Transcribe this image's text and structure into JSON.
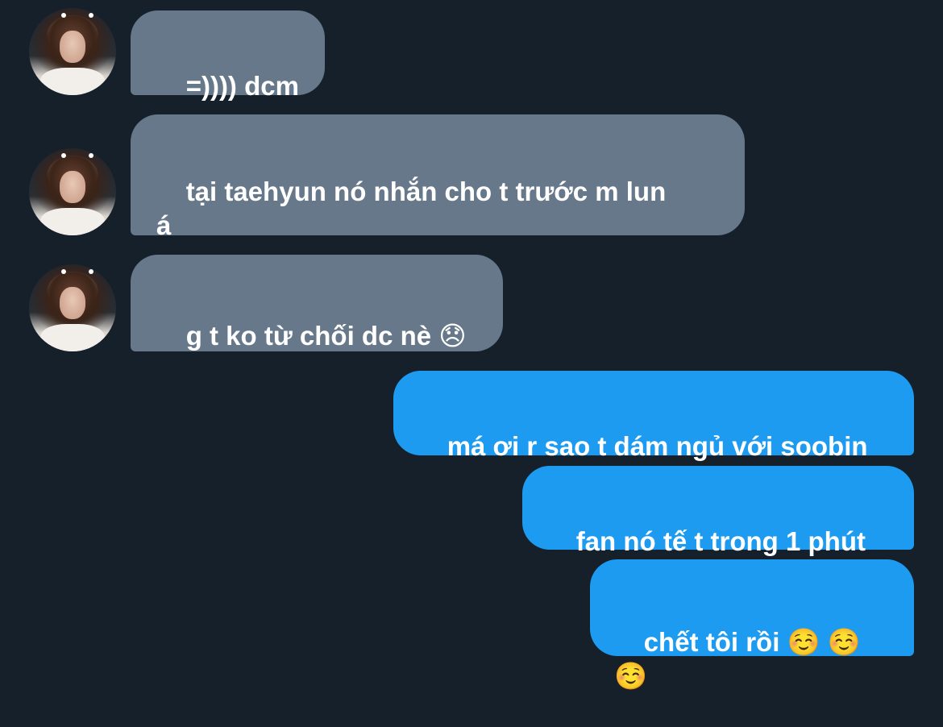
{
  "colors": {
    "background": "#16202b",
    "incoming_bubble": "#66788a",
    "outgoing_bubble": "#1d9bf0",
    "text": "#ffffff"
  },
  "messages": [
    {
      "direction": "incoming",
      "text": "=)))) dcm"
    },
    {
      "direction": "incoming",
      "text": "tại taehyun nó nhắn cho t trước m lun\ná"
    },
    {
      "direction": "incoming",
      "text": "g t ko từ chối dc nè 😞"
    },
    {
      "direction": "outgoing",
      "text": "má ơi r sao t dám ngủ với soobin"
    },
    {
      "direction": "outgoing",
      "text": "fan nó tế t trong 1 phút"
    },
    {
      "direction": "outgoing",
      "text": "chết tôi rồi ☺️ ☺️ ☺️"
    }
  ]
}
